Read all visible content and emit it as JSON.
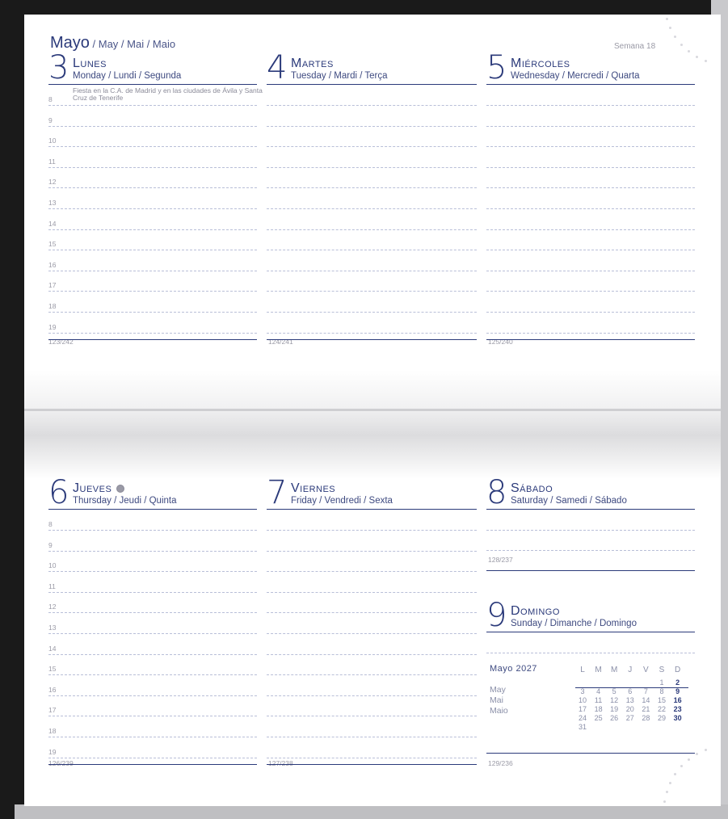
{
  "header": {
    "month": "Mayo",
    "month_alt": " / May / Mai / Maio",
    "week": "Semana 18"
  },
  "days": {
    "d3": {
      "num": "3",
      "name": "Lunes",
      "sub": "Monday / Lundi / Segunda",
      "note": "Fiesta en la C.A. de Madrid y en las ciudades de Ávila y Santa Cruz de Tenerife",
      "counter": "123/242"
    },
    "d4": {
      "num": "4",
      "name": "Martes",
      "sub": "Tuesday / Mardi / Terça",
      "counter": "124/241"
    },
    "d5": {
      "num": "5",
      "name": "Miércoles",
      "sub": "Wednesday / Mercredi / Quarta",
      "counter": "125/240"
    },
    "d6": {
      "num": "6",
      "name": "Jueves",
      "sub": "Thursday / Jeudi / Quinta",
      "counter": "126/239",
      "moon_icon": "moon-phase-icon"
    },
    "d7": {
      "num": "7",
      "name": "Viernes",
      "sub": "Friday / Vendredi / Sexta",
      "counter": "127/238"
    },
    "d8": {
      "num": "8",
      "name": "Sábado",
      "sub": "Saturday / Samedi / Sábado",
      "counter": "128/237"
    },
    "d9": {
      "num": "9",
      "name": "Domingo",
      "sub": "Sunday / Dimanche / Domingo",
      "counter": "129/236"
    }
  },
  "hours": [
    "8",
    "9",
    "10",
    "11",
    "12",
    "13",
    "14",
    "15",
    "16",
    "17",
    "18",
    "19"
  ],
  "mini_calendar": {
    "title": "Mayo 2027",
    "alt": [
      "May",
      "Mai",
      "Maio"
    ],
    "weekdays": [
      "L",
      "M",
      "M",
      "J",
      "V",
      "S",
      "D"
    ],
    "weeks": [
      [
        "",
        "",
        "",
        "",
        "",
        "1",
        "2"
      ],
      [
        "3",
        "4",
        "5",
        "6",
        "7",
        "8",
        "9"
      ],
      [
        "10",
        "11",
        "12",
        "13",
        "14",
        "15",
        "16"
      ],
      [
        "17",
        "18",
        "19",
        "20",
        "21",
        "22",
        "23"
      ],
      [
        "24",
        "25",
        "26",
        "27",
        "28",
        "29",
        "30"
      ],
      [
        "31",
        "",
        "",
        "",
        "",
        "",
        ""
      ]
    ]
  },
  "colors": {
    "accent": "#2b3a7a",
    "muted": "#9a9aa6",
    "dashed": "#b9bfd8"
  }
}
